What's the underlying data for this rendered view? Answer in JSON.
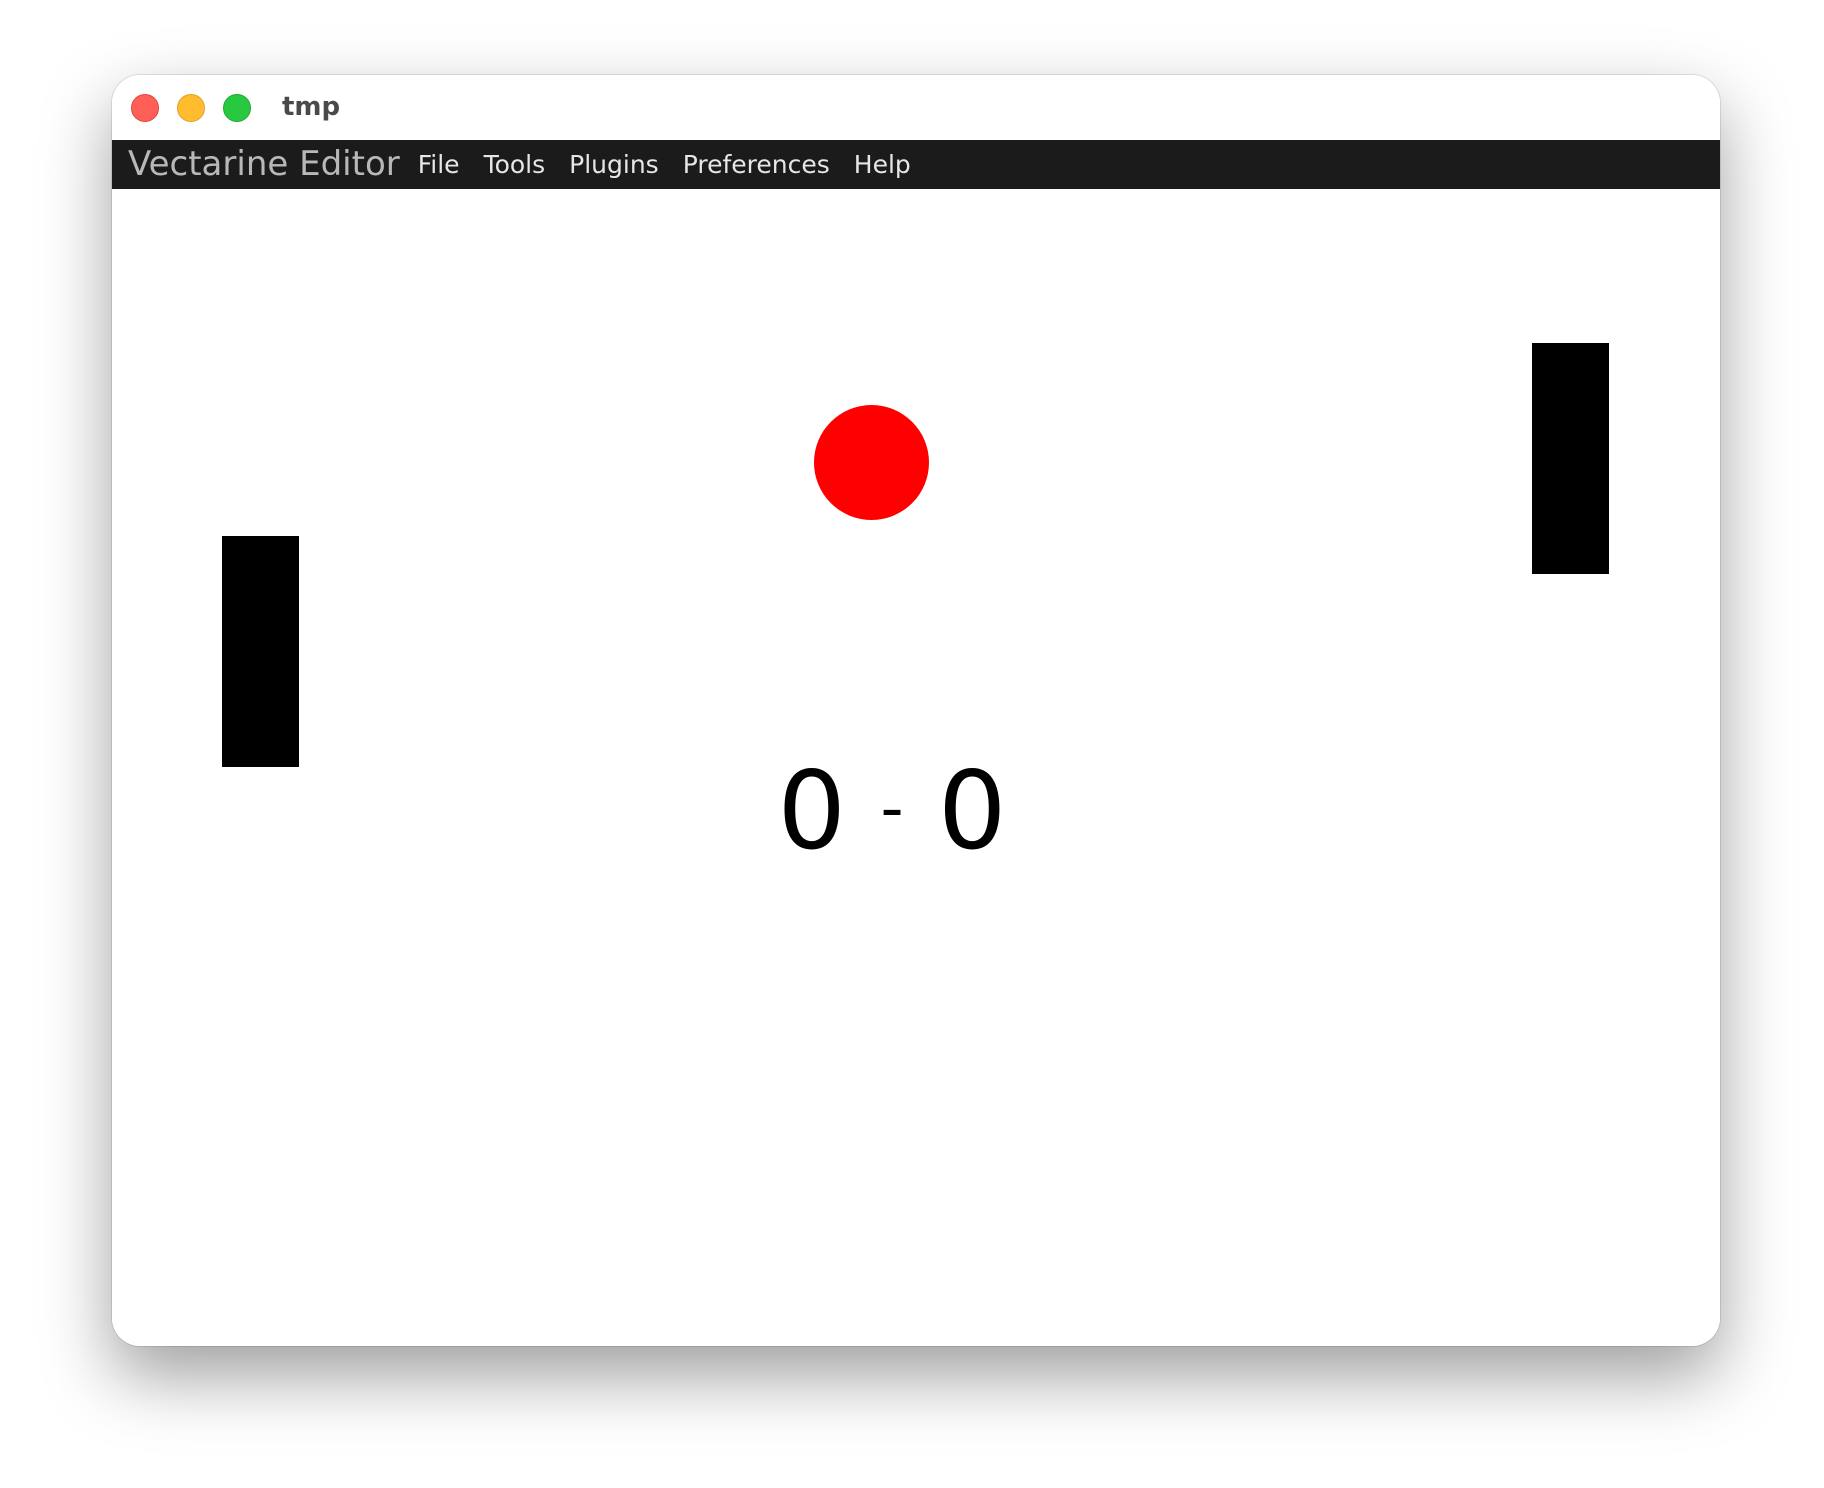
{
  "window": {
    "title": "tmp"
  },
  "menubar": {
    "app_name": "Vectarine Editor",
    "items": [
      {
        "label": "File"
      },
      {
        "label": "Tools"
      },
      {
        "label": "Plugins"
      },
      {
        "label": "Preferences"
      },
      {
        "label": "Help"
      }
    ]
  },
  "game": {
    "score_left": "0",
    "score_separator": "-",
    "score_right": "0",
    "ball_color": "#ff0000",
    "paddle_color": "#000000"
  }
}
